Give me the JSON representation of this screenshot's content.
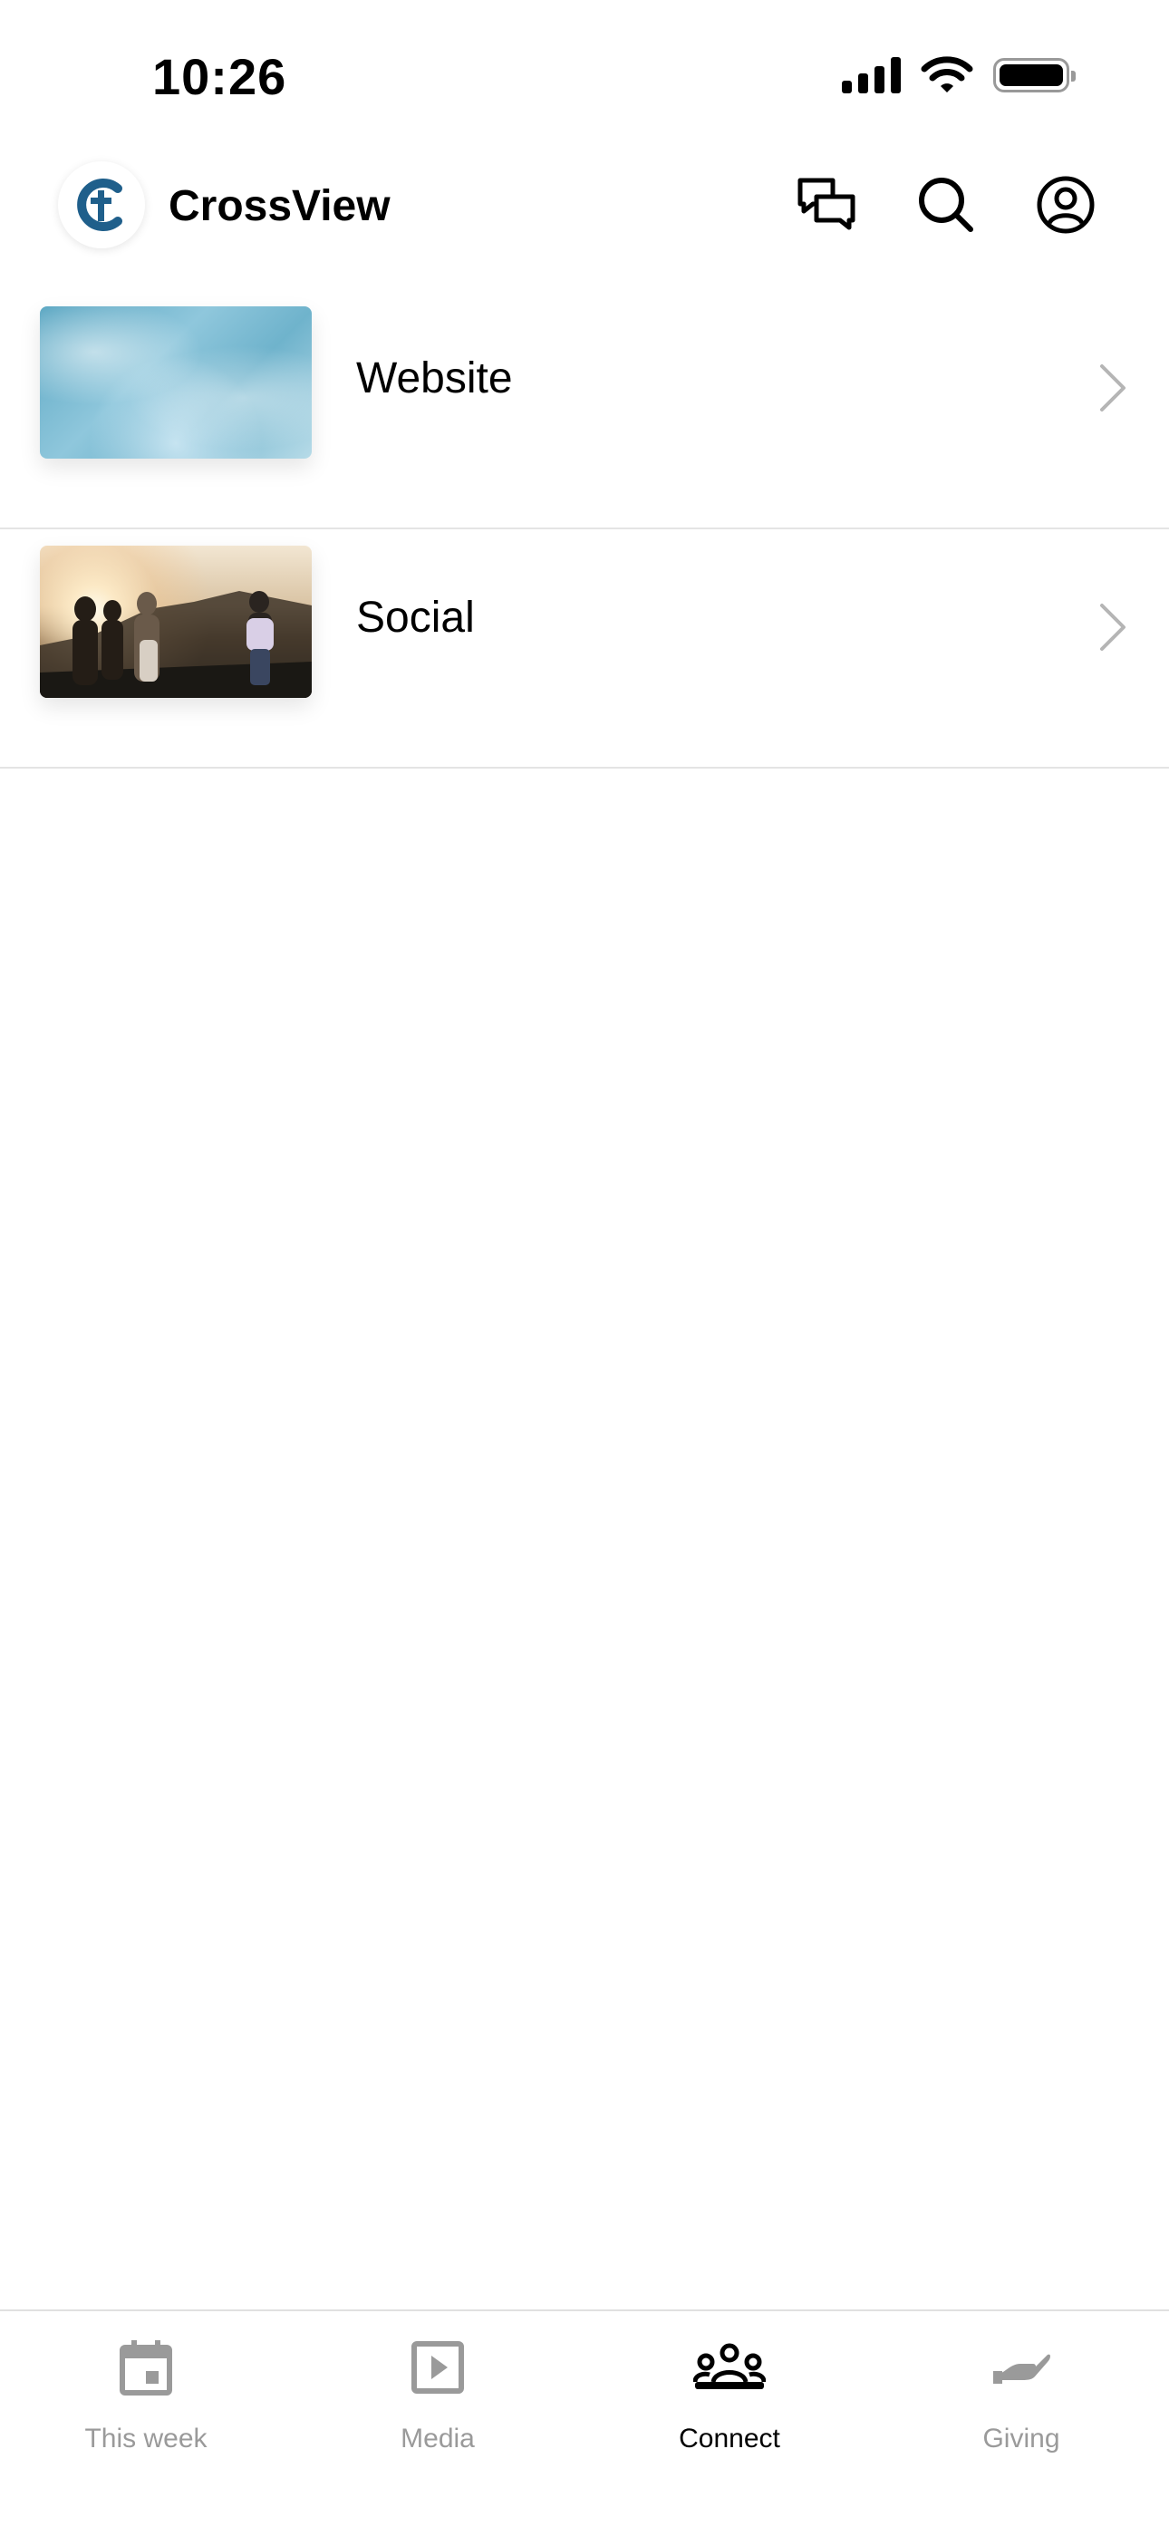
{
  "status_bar": {
    "time": "10:26"
  },
  "header": {
    "title": "CrossView",
    "logo_icon": "crossview-logo",
    "icons": [
      "messages-icon",
      "search-icon",
      "profile-icon"
    ]
  },
  "list": {
    "items": [
      {
        "label": "Website",
        "thumbnail": "water-texture-image"
      },
      {
        "label": "Social",
        "thumbnail": "people-at-sunset-image"
      }
    ]
  },
  "tab_bar": {
    "tabs": [
      {
        "label": "This week",
        "icon": "calendar-icon",
        "active": false
      },
      {
        "label": "Media",
        "icon": "play-icon",
        "active": false
      },
      {
        "label": "Connect",
        "icon": "group-icon",
        "active": true
      },
      {
        "label": "Giving",
        "icon": "hand-icon",
        "active": false
      }
    ]
  },
  "colors": {
    "brand": "#1f5f8b",
    "active_tab": "#000000",
    "inactive_tab": "#9a9a9a",
    "divider": "#e4e4e4"
  }
}
